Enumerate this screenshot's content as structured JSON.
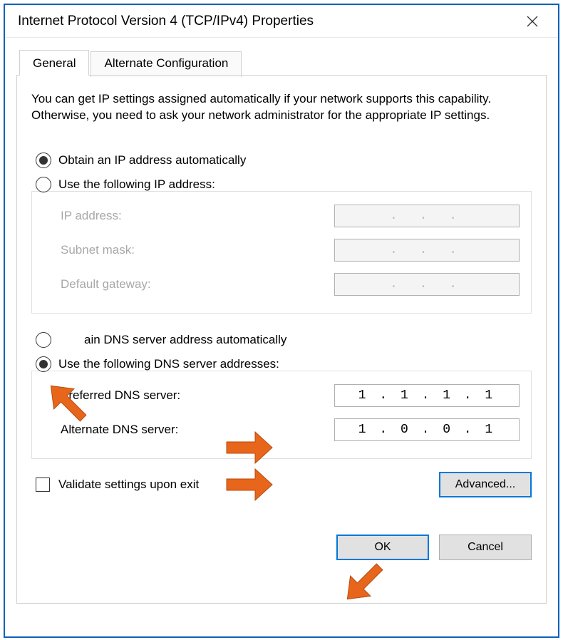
{
  "window": {
    "title": "Internet Protocol Version 4 (TCP/IPv4) Properties"
  },
  "tabs": {
    "general": "General",
    "alternate": "Alternate Configuration"
  },
  "description": "You can get IP settings assigned automatically if your network supports this capability. Otherwise, you need to ask your network administrator for the appropriate IP settings.",
  "ip_section": {
    "radio_auto": "Obtain an IP address automatically",
    "radio_manual": "Use the following IP address:",
    "ip_address_label": "IP address:",
    "subnet_label": "Subnet mask:",
    "gateway_label": "Default gateway:",
    "disabled_value": ".   .   ."
  },
  "dns_section": {
    "radio_auto": "Obtain DNS server address automatically",
    "radio_manual": "Use the following DNS server addresses:",
    "preferred_label": "Preferred DNS server:",
    "alternate_label": "Alternate DNS server:",
    "preferred_value": "1 . 1 . 1 . 1",
    "alternate_value": "1 . 0 . 0 . 1"
  },
  "validate_label": "Validate settings upon exit",
  "buttons": {
    "advanced": "Advanced...",
    "ok": "OK",
    "cancel": "Cancel"
  }
}
